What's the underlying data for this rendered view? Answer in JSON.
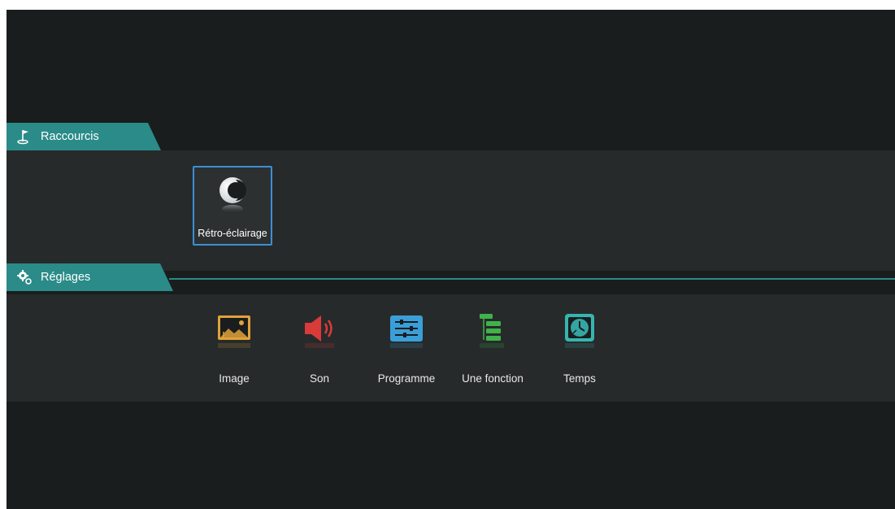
{
  "sections": {
    "shortcuts": {
      "title": "Raccourcis",
      "icon": "golf-flag-icon"
    },
    "settings": {
      "title": "Réglages",
      "icon": "gears-icon"
    }
  },
  "shortcuts": [
    {
      "label": "Rétro-éclairage",
      "icon": "backlight-moon-icon",
      "focused": true
    }
  ],
  "settings_items": [
    {
      "label": "Image",
      "icon": "picture-icon",
      "color": "#e0a23a"
    },
    {
      "label": "Son",
      "icon": "speaker-icon",
      "color": "#d93a3a"
    },
    {
      "label": "Programme",
      "icon": "sliders-icon",
      "color": "#3a9fd8"
    },
    {
      "label": "Une fonction",
      "icon": "list-icon",
      "color": "#3fb24a"
    },
    {
      "label": "Temps",
      "icon": "clock-icon",
      "color": "#36b5b0"
    }
  ],
  "colors": {
    "accent": "#2a8b88",
    "focus_border": "#3b8fd6",
    "background": "#1a1d1e",
    "band": "#272a2b"
  }
}
